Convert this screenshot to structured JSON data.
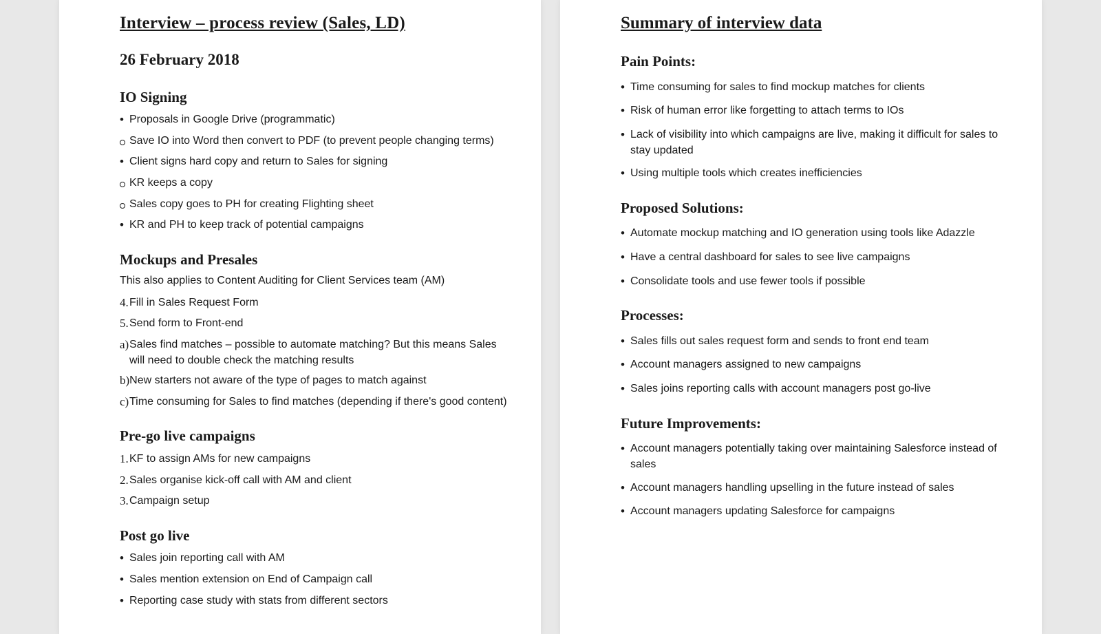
{
  "left": {
    "title": "Interview – process review (Sales, LD)",
    "date": "26 February 2018",
    "sections": {
      "io": {
        "heading": "IO Signing",
        "items": [
          "Proposals in Google Drive (programmatic)",
          "Save IO into Word then convert to PDF (to prevent people changing terms)",
          "Client signs hard copy and return to Sales for signing",
          "KR keeps a copy",
          "Sales copy goes to PH for creating Flighting sheet",
          "KR and PH to keep track of potential campaigns"
        ]
      },
      "mockups": {
        "heading": "Mockups and Presales",
        "intro": "This also applies to Content Auditing for Client Services team (AM)",
        "items": [
          "Fill in Sales Request Form",
          "Send form to Front-end",
          "Sales find matches – possible to automate matching? But this means Sales will need to double check the matching results",
          "New starters not aware of the type of pages to match against",
          "Time consuming for Sales to find matches (depending if there's good content)"
        ]
      },
      "pre": {
        "heading": "Pre-go live campaigns",
        "items": [
          "KF to assign AMs for new campaigns",
          "Sales organise kick-off call with AM and client",
          "Campaign setup"
        ]
      },
      "post": {
        "heading": "Post go live",
        "items": [
          "Sales join reporting call with AM",
          "Sales mention extension on End of Campaign call",
          "Reporting case study with stats from different sectors"
        ]
      }
    }
  },
  "right": {
    "title": "Summary of interview data",
    "sections": {
      "pain": {
        "heading": "Pain Points:",
        "items": [
          "Time consuming for sales to find mockup matches for clients",
          "Risk of human error like forgetting to attach terms to IOs",
          "Lack of visibility into which campaigns are live, making it difficult for sales to stay updated",
          "Using multiple tools which creates inefficiencies"
        ]
      },
      "solutions": {
        "heading": "Proposed Solutions:",
        "items": [
          "Automate mockup matching and IO generation using tools like Adazzle",
          "Have a central dashboard for sales to see live campaigns",
          "Consolidate tools and use fewer tools if possible"
        ]
      },
      "processes": {
        "heading": "Processes:",
        "items": [
          "Sales fills out sales request form and sends to front end team",
          "Account managers assigned to new campaigns",
          "Sales joins reporting calls with account managers post go-live"
        ]
      },
      "future": {
        "heading": "Future Improvements:",
        "items": [
          "Account managers potentially taking over maintaining Salesforce instead of sales",
          "Account managers handling upselling in the future instead of sales",
          "Account managers updating Salesforce for campaigns"
        ]
      }
    }
  }
}
